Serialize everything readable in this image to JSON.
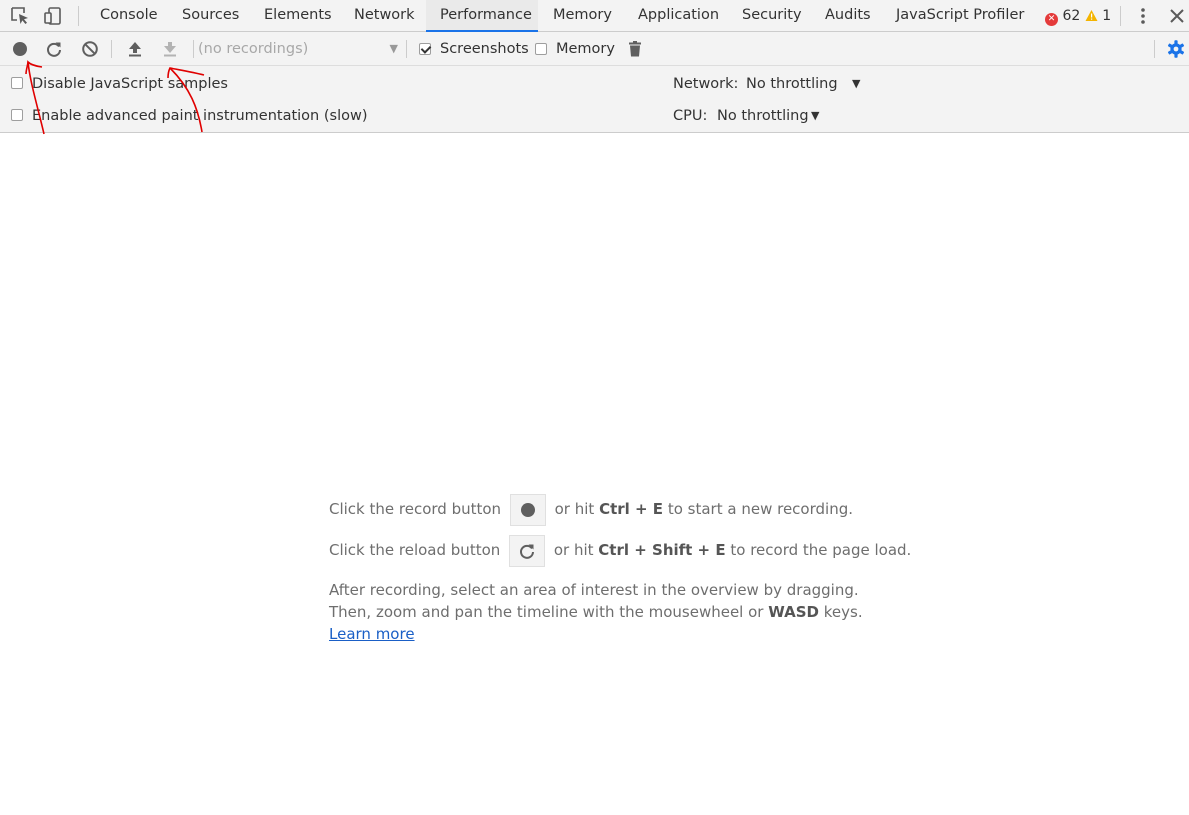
{
  "tabbar": {
    "inspect_icon": "inspect-element-icon",
    "device_icon": "device-toolbar-icon",
    "tabs": [
      {
        "label": "Console"
      },
      {
        "label": "Sources"
      },
      {
        "label": "Elements"
      },
      {
        "label": "Network"
      },
      {
        "label": "Performance",
        "active": true
      },
      {
        "label": "Memory"
      },
      {
        "label": "Application"
      },
      {
        "label": "Security"
      },
      {
        "label": "Audits"
      },
      {
        "label": "JavaScript Profiler"
      }
    ],
    "errors": "62",
    "warnings": "1",
    "menu_icon": "kebab-menu-icon",
    "close_icon": "close-icon"
  },
  "toolbar": {
    "recordings_placeholder": "(no recordings)",
    "screenshots_label": "Screenshots",
    "screenshots_checked": true,
    "memory_label": "Memory",
    "memory_checked": false
  },
  "settings": {
    "disable_js_samples": "Disable JavaScript samples",
    "enable_paint": "Enable advanced paint instrumentation (slow)",
    "network_label": "Network:",
    "network_value": "No throttling",
    "cpu_label": "CPU:",
    "cpu_value": "No throttling"
  },
  "landing": {
    "record_prefix": "Click the record button",
    "record_mid": "or hit",
    "record_keys": "Ctrl + E",
    "record_suffix": "to start a new recording.",
    "reload_prefix": "Click the reload button",
    "reload_mid": "or hit",
    "reload_keys": "Ctrl + Shift + E",
    "reload_suffix": "to record the page load.",
    "after_line1": "After recording, select an area of interest in the overview by dragging.",
    "after_line2_prefix": "Then, zoom and pan the timeline with the mousewheel or",
    "after_line2_keys": "WASD",
    "after_line2_suffix": "keys.",
    "learn_more": "Learn more"
  },
  "colors": {
    "accent": "#1a73e8",
    "error": "#e43a3a",
    "warning": "#f4b400",
    "annotation": "#e00000"
  }
}
